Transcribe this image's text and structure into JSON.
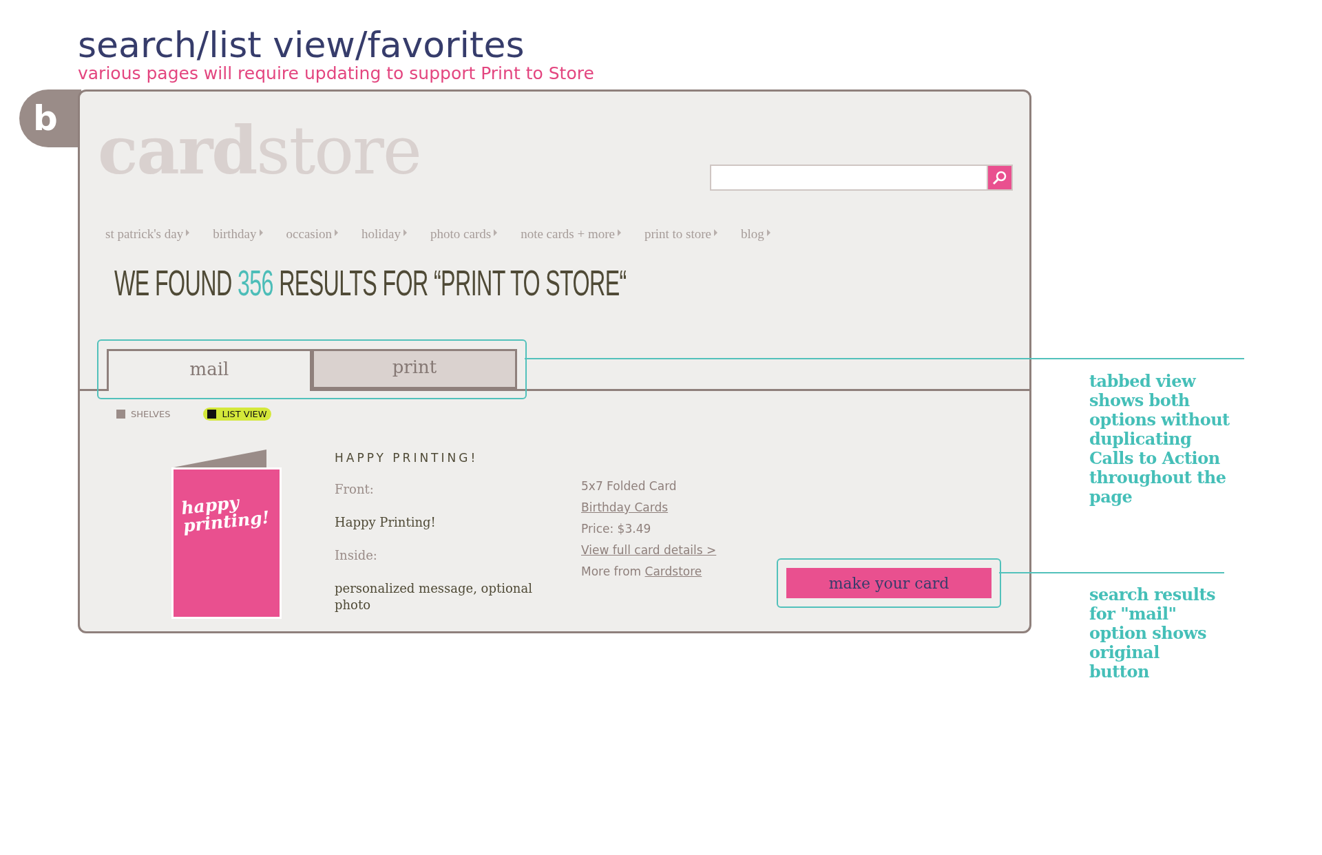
{
  "doc_title": "search/list view/favorites",
  "doc_subtitle": "various pages will require updating to support Print to Store",
  "section_badge": "b",
  "logo": {
    "bold_part": "card",
    "light_part": "store"
  },
  "nav": [
    "st patrick's day",
    "birthday",
    "occasion",
    "holiday",
    "photo cards",
    "note cards + more",
    "print to store",
    "blog"
  ],
  "results_heading": {
    "prefix": "WE FOUND ",
    "count": "356",
    "suffix": " RESULTS FOR “PRINT TO STORE“"
  },
  "tabs": [
    {
      "label": "mail",
      "selected": true
    },
    {
      "label": "print",
      "selected": false
    }
  ],
  "view_options": [
    {
      "label": "SHELVES",
      "selected": false
    },
    {
      "label": "LIST VIEW",
      "selected": true
    }
  ],
  "product": {
    "card_text": [
      "happy",
      "printing!"
    ],
    "title": "HAPPY PRINTING!",
    "front_label": "Front:",
    "front_value": "Happy Printing!",
    "inside_label": "Inside:",
    "inside_value": "personalized message, optional photo",
    "size": "5x7 Folded Card",
    "category": "Birthday Cards",
    "price": "Price: $3.49",
    "details_link": "View full card details >",
    "more_from": "More from ",
    "brand_link": "Cardstore",
    "button": "make your card"
  },
  "annotations": [
    {
      "lines": [
        "tabbed view",
        "shows both",
        "options without",
        "duplicating",
        "Calls to Action",
        "throughout the",
        "page"
      ]
    },
    {
      "lines": [
        "search results",
        "for \"mail\"",
        "option shows",
        "original",
        "button"
      ]
    }
  ]
}
